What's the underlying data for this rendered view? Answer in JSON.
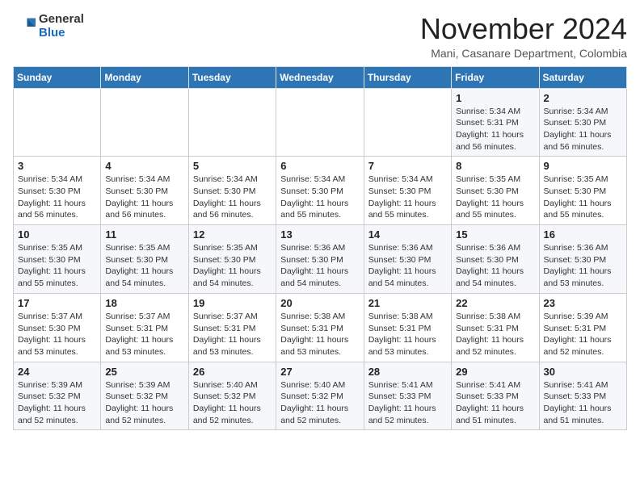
{
  "logo": {
    "general": "General",
    "blue": "Blue"
  },
  "header": {
    "month_year": "November 2024",
    "location": "Mani, Casanare Department, Colombia"
  },
  "days_of_week": [
    "Sunday",
    "Monday",
    "Tuesday",
    "Wednesday",
    "Thursday",
    "Friday",
    "Saturday"
  ],
  "weeks": [
    [
      {
        "day": "",
        "info": ""
      },
      {
        "day": "",
        "info": ""
      },
      {
        "day": "",
        "info": ""
      },
      {
        "day": "",
        "info": ""
      },
      {
        "day": "",
        "info": ""
      },
      {
        "day": "1",
        "info": "Sunrise: 5:34 AM\nSunset: 5:31 PM\nDaylight: 11 hours and 56 minutes."
      },
      {
        "day": "2",
        "info": "Sunrise: 5:34 AM\nSunset: 5:30 PM\nDaylight: 11 hours and 56 minutes."
      }
    ],
    [
      {
        "day": "3",
        "info": "Sunrise: 5:34 AM\nSunset: 5:30 PM\nDaylight: 11 hours and 56 minutes."
      },
      {
        "day": "4",
        "info": "Sunrise: 5:34 AM\nSunset: 5:30 PM\nDaylight: 11 hours and 56 minutes."
      },
      {
        "day": "5",
        "info": "Sunrise: 5:34 AM\nSunset: 5:30 PM\nDaylight: 11 hours and 56 minutes."
      },
      {
        "day": "6",
        "info": "Sunrise: 5:34 AM\nSunset: 5:30 PM\nDaylight: 11 hours and 55 minutes."
      },
      {
        "day": "7",
        "info": "Sunrise: 5:34 AM\nSunset: 5:30 PM\nDaylight: 11 hours and 55 minutes."
      },
      {
        "day": "8",
        "info": "Sunrise: 5:35 AM\nSunset: 5:30 PM\nDaylight: 11 hours and 55 minutes."
      },
      {
        "day": "9",
        "info": "Sunrise: 5:35 AM\nSunset: 5:30 PM\nDaylight: 11 hours and 55 minutes."
      }
    ],
    [
      {
        "day": "10",
        "info": "Sunrise: 5:35 AM\nSunset: 5:30 PM\nDaylight: 11 hours and 55 minutes."
      },
      {
        "day": "11",
        "info": "Sunrise: 5:35 AM\nSunset: 5:30 PM\nDaylight: 11 hours and 54 minutes."
      },
      {
        "day": "12",
        "info": "Sunrise: 5:35 AM\nSunset: 5:30 PM\nDaylight: 11 hours and 54 minutes."
      },
      {
        "day": "13",
        "info": "Sunrise: 5:36 AM\nSunset: 5:30 PM\nDaylight: 11 hours and 54 minutes."
      },
      {
        "day": "14",
        "info": "Sunrise: 5:36 AM\nSunset: 5:30 PM\nDaylight: 11 hours and 54 minutes."
      },
      {
        "day": "15",
        "info": "Sunrise: 5:36 AM\nSunset: 5:30 PM\nDaylight: 11 hours and 54 minutes."
      },
      {
        "day": "16",
        "info": "Sunrise: 5:36 AM\nSunset: 5:30 PM\nDaylight: 11 hours and 53 minutes."
      }
    ],
    [
      {
        "day": "17",
        "info": "Sunrise: 5:37 AM\nSunset: 5:30 PM\nDaylight: 11 hours and 53 minutes."
      },
      {
        "day": "18",
        "info": "Sunrise: 5:37 AM\nSunset: 5:31 PM\nDaylight: 11 hours and 53 minutes."
      },
      {
        "day": "19",
        "info": "Sunrise: 5:37 AM\nSunset: 5:31 PM\nDaylight: 11 hours and 53 minutes."
      },
      {
        "day": "20",
        "info": "Sunrise: 5:38 AM\nSunset: 5:31 PM\nDaylight: 11 hours and 53 minutes."
      },
      {
        "day": "21",
        "info": "Sunrise: 5:38 AM\nSunset: 5:31 PM\nDaylight: 11 hours and 53 minutes."
      },
      {
        "day": "22",
        "info": "Sunrise: 5:38 AM\nSunset: 5:31 PM\nDaylight: 11 hours and 52 minutes."
      },
      {
        "day": "23",
        "info": "Sunrise: 5:39 AM\nSunset: 5:31 PM\nDaylight: 11 hours and 52 minutes."
      }
    ],
    [
      {
        "day": "24",
        "info": "Sunrise: 5:39 AM\nSunset: 5:32 PM\nDaylight: 11 hours and 52 minutes."
      },
      {
        "day": "25",
        "info": "Sunrise: 5:39 AM\nSunset: 5:32 PM\nDaylight: 11 hours and 52 minutes."
      },
      {
        "day": "26",
        "info": "Sunrise: 5:40 AM\nSunset: 5:32 PM\nDaylight: 11 hours and 52 minutes."
      },
      {
        "day": "27",
        "info": "Sunrise: 5:40 AM\nSunset: 5:32 PM\nDaylight: 11 hours and 52 minutes."
      },
      {
        "day": "28",
        "info": "Sunrise: 5:41 AM\nSunset: 5:33 PM\nDaylight: 11 hours and 52 minutes."
      },
      {
        "day": "29",
        "info": "Sunrise: 5:41 AM\nSunset: 5:33 PM\nDaylight: 11 hours and 51 minutes."
      },
      {
        "day": "30",
        "info": "Sunrise: 5:41 AM\nSunset: 5:33 PM\nDaylight: 11 hours and 51 minutes."
      }
    ]
  ]
}
